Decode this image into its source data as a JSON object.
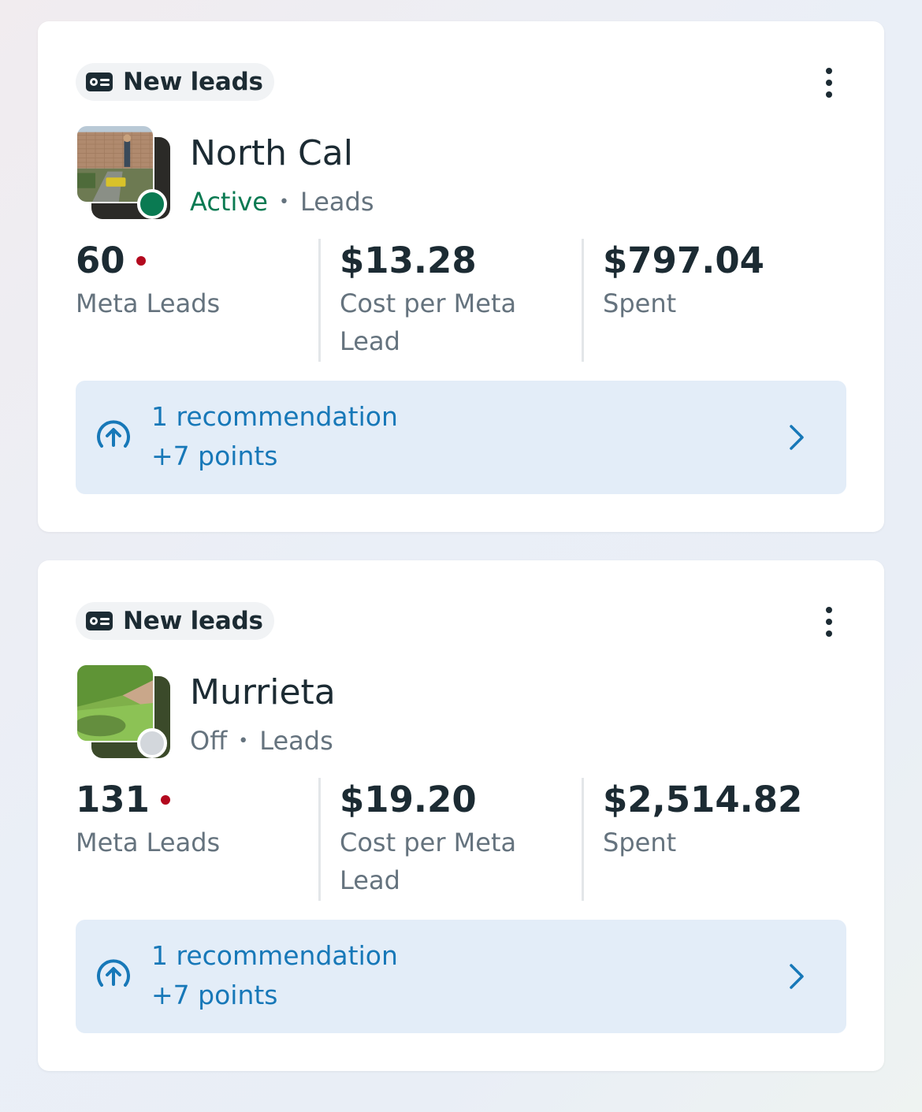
{
  "colors": {
    "active_status": "#0a7a52",
    "off_status": "#d3d7dc",
    "alert_dot": "#b3091e",
    "link_blue": "#1778b8",
    "recommendation_bg": "#e3edf8"
  },
  "campaigns": [
    {
      "badge_icon": "lead-card-icon",
      "badge_label": "New leads",
      "name": "North Cal",
      "status": "Active",
      "separator": "•",
      "objective": "Leads",
      "metrics": {
        "leads_value": "60",
        "leads_label": "Meta Leads",
        "cpl_value": "$13.28",
        "cpl_label": "Cost per Meta Lead",
        "spent_value": "$797.04",
        "spent_label": "Spent"
      },
      "recommendation": {
        "title": "1 recommendation",
        "points": "+7 points"
      }
    },
    {
      "badge_icon": "lead-card-icon",
      "badge_label": "New leads",
      "name": "Murrieta",
      "status": "Off",
      "separator": "•",
      "objective": "Leads",
      "metrics": {
        "leads_value": "131",
        "leads_label": "Meta Leads",
        "cpl_value": "$19.20",
        "cpl_label": "Cost per Meta Lead",
        "spent_value": "$2,514.82",
        "spent_label": "Spent"
      },
      "recommendation": {
        "title": "1 recommendation",
        "points": "+7 points"
      }
    }
  ]
}
